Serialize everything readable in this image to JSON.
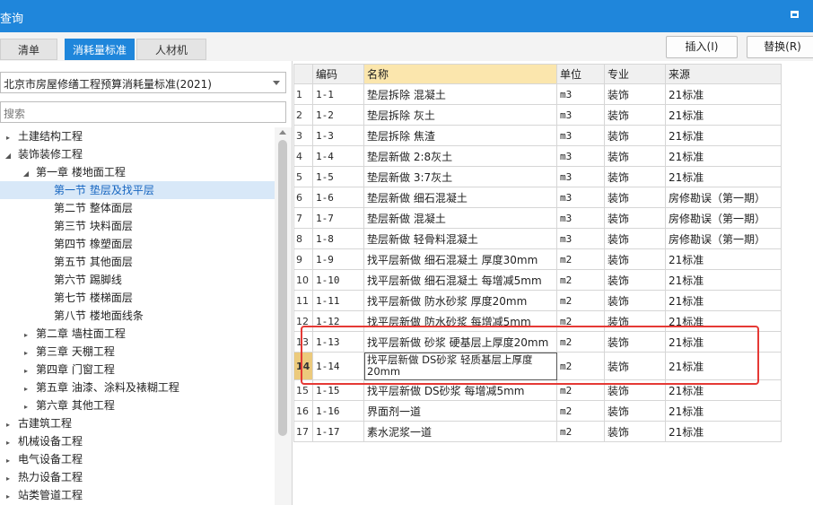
{
  "window": {
    "title": "查询"
  },
  "tabs": [
    "清单",
    "消耗量标准",
    "人材机"
  ],
  "toolbar": {
    "insert_label": "插入(I)",
    "replace_label": "替换(R)"
  },
  "left": {
    "standard_selected": "北京市房屋修缮工程预算消耗量标准(2021)",
    "search_placeholder": "搜索",
    "tree": [
      {
        "label": "土建结构工程",
        "level": 0,
        "toggle": "collapsed"
      },
      {
        "label": "装饰装修工程",
        "level": 0,
        "toggle": "expanded"
      },
      {
        "label": "第一章 楼地面工程",
        "level": 1,
        "toggle": "expanded"
      },
      {
        "label": "第一节 垫层及找平层",
        "level": 2,
        "toggle": "none",
        "selected": true
      },
      {
        "label": "第二节 整体面层",
        "level": 2,
        "toggle": "none"
      },
      {
        "label": "第三节 块料面层",
        "level": 2,
        "toggle": "none"
      },
      {
        "label": "第四节 橡塑面层",
        "level": 2,
        "toggle": "none"
      },
      {
        "label": "第五节 其他面层",
        "level": 2,
        "toggle": "none"
      },
      {
        "label": "第六节 踢脚线",
        "level": 2,
        "toggle": "none"
      },
      {
        "label": "第七节 楼梯面层",
        "level": 2,
        "toggle": "none"
      },
      {
        "label": "第八节 楼地面线条",
        "level": 2,
        "toggle": "none"
      },
      {
        "label": "第二章 墙柱面工程",
        "level": 1,
        "toggle": "collapsed"
      },
      {
        "label": "第三章 天棚工程",
        "level": 1,
        "toggle": "collapsed"
      },
      {
        "label": "第四章 门窗工程",
        "level": 1,
        "toggle": "collapsed"
      },
      {
        "label": "第五章 油漆、涂料及裱糊工程",
        "level": 1,
        "toggle": "collapsed"
      },
      {
        "label": "第六章 其他工程",
        "level": 1,
        "toggle": "collapsed"
      },
      {
        "label": "古建筑工程",
        "level": 0,
        "toggle": "collapsed"
      },
      {
        "label": "机械设备工程",
        "level": 0,
        "toggle": "collapsed"
      },
      {
        "label": "电气设备工程",
        "level": 0,
        "toggle": "collapsed"
      },
      {
        "label": "热力设备工程",
        "level": 0,
        "toggle": "collapsed"
      },
      {
        "label": "站类管道工程",
        "level": 0,
        "toggle": "collapsed"
      }
    ]
  },
  "grid": {
    "columns": [
      "编码",
      "名称",
      "单位",
      "专业",
      "来源"
    ],
    "active_row": 14,
    "rows": [
      {
        "n": "1",
        "code": "1-1",
        "name": "垫层拆除 混凝土",
        "unit": "m3",
        "major": "装饰",
        "source": "21标准"
      },
      {
        "n": "2",
        "code": "1-2",
        "name": "垫层拆除 灰土",
        "unit": "m3",
        "major": "装饰",
        "source": "21标准"
      },
      {
        "n": "3",
        "code": "1-3",
        "name": "垫层拆除 焦渣",
        "unit": "m3",
        "major": "装饰",
        "source": "21标准"
      },
      {
        "n": "4",
        "code": "1-4",
        "name": "垫层新做 2:8灰土",
        "unit": "m3",
        "major": "装饰",
        "source": "21标准"
      },
      {
        "n": "5",
        "code": "1-5",
        "name": "垫层新做 3:7灰土",
        "unit": "m3",
        "major": "装饰",
        "source": "21标准"
      },
      {
        "n": "6",
        "code": "1-6",
        "name": "垫层新做 细石混凝土",
        "unit": "m3",
        "major": "装饰",
        "source": "房修勘误（第一期）"
      },
      {
        "n": "7",
        "code": "1-7",
        "name": "垫层新做 混凝土",
        "unit": "m3",
        "major": "装饰",
        "source": "房修勘误（第一期）"
      },
      {
        "n": "8",
        "code": "1-8",
        "name": "垫层新做 轻骨料混凝土",
        "unit": "m3",
        "major": "装饰",
        "source": "房修勘误（第一期）"
      },
      {
        "n": "9",
        "code": "1-9",
        "name": "找平层新做 细石混凝土 厚度30mm",
        "unit": "m2",
        "major": "装饰",
        "source": "21标准"
      },
      {
        "n": "10",
        "code": "1-10",
        "name": "找平层新做 细石混凝土 每增减5mm",
        "unit": "m2",
        "major": "装饰",
        "source": "21标准"
      },
      {
        "n": "11",
        "code": "1-11",
        "name": "找平层新做 防水砂浆 厚度20mm",
        "unit": "m2",
        "major": "装饰",
        "source": "21标准"
      },
      {
        "n": "12",
        "code": "1-12",
        "name": "找平层新做 防水砂浆 每增减5mm",
        "unit": "m2",
        "major": "装饰",
        "source": "21标准"
      },
      {
        "n": "13",
        "code": "1-13",
        "name": "找平层新做 砂浆 硬基层上厚度20mm",
        "unit": "m2",
        "major": "装饰",
        "source": "21标准"
      },
      {
        "n": "14",
        "code": "1-14",
        "name": "找平层新做 DS砂浆 轻质基层上厚度20mm",
        "unit": "m2",
        "major": "装饰",
        "source": "21标准"
      },
      {
        "n": "15",
        "code": "1-15",
        "name": "找平层新做 DS砂浆 每增减5mm",
        "unit": "m2",
        "major": "装饰",
        "source": "21标准"
      },
      {
        "n": "16",
        "code": "1-16",
        "name": "界面剂一道",
        "unit": "m2",
        "major": "装饰",
        "source": "21标准"
      },
      {
        "n": "17",
        "code": "1-17",
        "name": "素水泥浆一道",
        "unit": "m2",
        "major": "装饰",
        "source": "21标准"
      }
    ]
  },
  "colors": {
    "accent": "#1f86db",
    "highlight_box": "#e53935",
    "name_header": "#fbe6ad"
  }
}
